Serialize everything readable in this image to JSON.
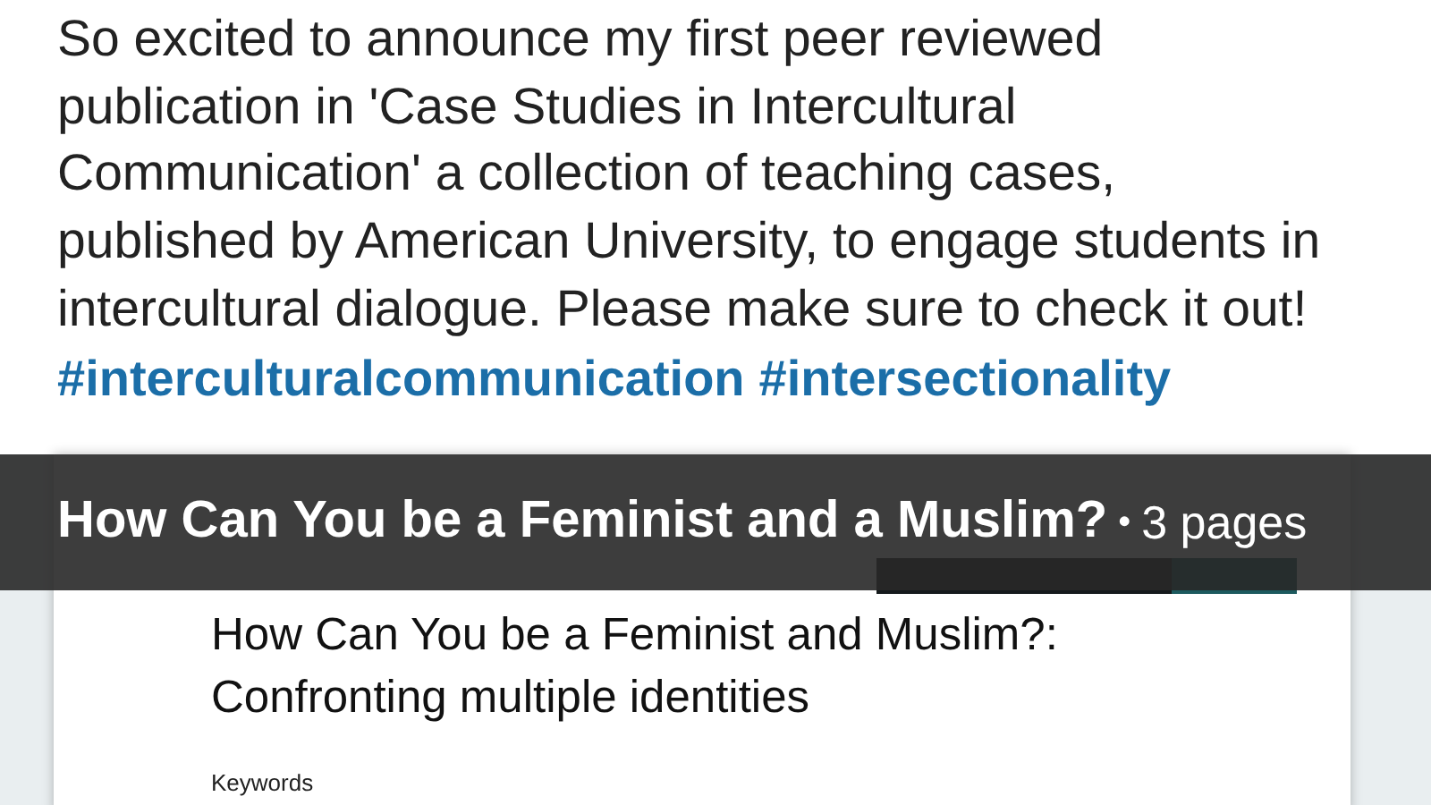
{
  "post": {
    "text": "So excited to announce my first peer reviewed publication in 'Case Studies in Intercultural Communication' a collection of teaching cases, published by American University, to engage students in intercultural dialogue. Please make sure to check it out!",
    "hashtags": [
      "#interculturalcommunication",
      "#intersectionality"
    ]
  },
  "document": {
    "title": "How Can You be a Feminist and a Muslim?",
    "separator": "•",
    "page_count": "3 pages",
    "page": {
      "heading": "How Can You be a Feminist and Muslim?: Confronting multiple identities",
      "section_label": "Keywords"
    }
  }
}
